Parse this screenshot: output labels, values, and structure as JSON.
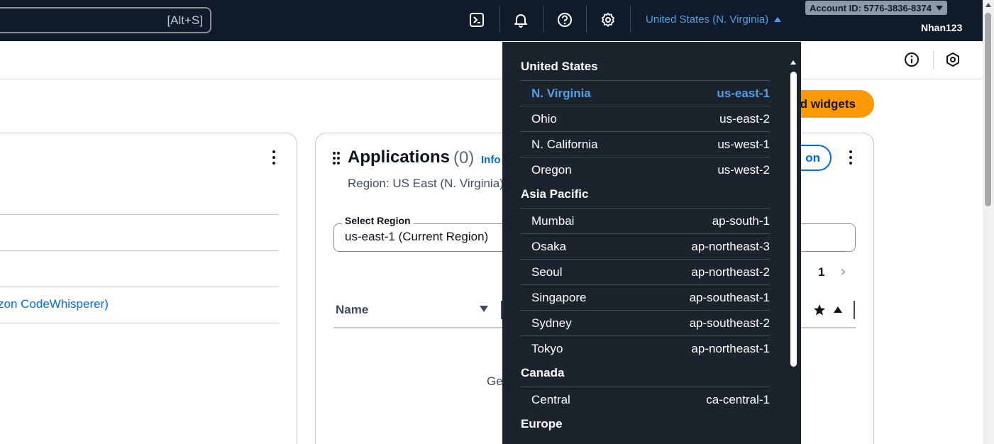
{
  "topnav": {
    "search_shortcut": "[Alt+S]",
    "region_label": "United States (N. Virginia)",
    "account_label": "Account ID: 5776-3836-8374",
    "username": "Nhan123",
    "icons": [
      "cloudshell-icon",
      "bell-icon",
      "help-icon",
      "gear-icon"
    ]
  },
  "toolbar": {
    "add_widgets_label": "d widgets"
  },
  "left_card": {
    "link_text": "zon CodeWhisperer)"
  },
  "applications": {
    "title": "Applications",
    "count": "(0)",
    "info": "Info",
    "region_text": "Region: US East (N. Virginia)",
    "create_label": "on",
    "select_label": "Select Region",
    "select_value": "us-east-1 (Current Region)",
    "page": "1",
    "column_name": "Name",
    "empty_text": "Get"
  },
  "region_menu": {
    "groups": [
      {
        "name": "United States",
        "items": [
          {
            "name": "N. Virginia",
            "code": "us-east-1",
            "selected": true
          },
          {
            "name": "Ohio",
            "code": "us-east-2"
          },
          {
            "name": "N. California",
            "code": "us-west-1"
          },
          {
            "name": "Oregon",
            "code": "us-west-2"
          }
        ]
      },
      {
        "name": "Asia Pacific",
        "items": [
          {
            "name": "Mumbai",
            "code": "ap-south-1"
          },
          {
            "name": "Osaka",
            "code": "ap-northeast-3"
          },
          {
            "name": "Seoul",
            "code": "ap-northeast-2"
          },
          {
            "name": "Singapore",
            "code": "ap-southeast-1"
          },
          {
            "name": "Sydney",
            "code": "ap-southeast-2"
          },
          {
            "name": "Tokyo",
            "code": "ap-northeast-1"
          }
        ]
      },
      {
        "name": "Canada",
        "items": [
          {
            "name": "Central",
            "code": "ca-central-1"
          }
        ]
      },
      {
        "name": "Europe",
        "items": []
      }
    ]
  },
  "colors": {
    "nav_bg": "#0f1b2a",
    "menu_bg": "#1b232d",
    "accent_blue": "#539fe5",
    "link_blue": "#006ce0",
    "primary_orange": "#ff9900"
  }
}
